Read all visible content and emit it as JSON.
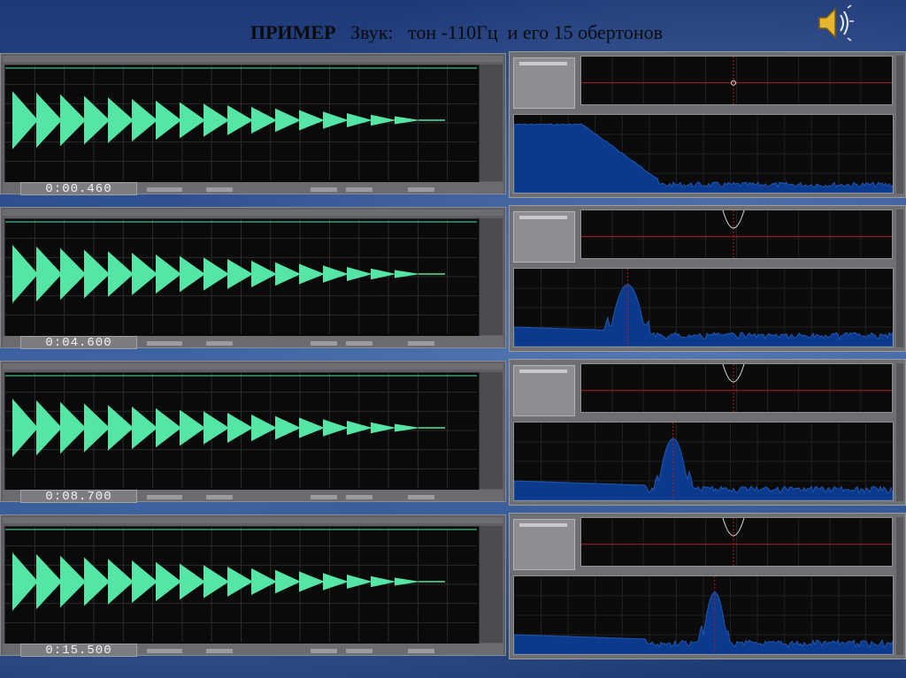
{
  "header": {
    "title_bold": "ПРИМЕР",
    "title_rest": "Звук:   тон -110Гц  и его 15 обертонов",
    "speaker_icon": "speaker-volume-icon"
  },
  "colors": {
    "waveform": "#55e6a6",
    "spectrum": "#0b3a8c",
    "spectrum_edge": "#1f57b5",
    "grid": "#2b2b2b",
    "red_line": "#b32020"
  },
  "panels": [
    {
      "time": "0:00.460",
      "peak_fraction": 0.0
    },
    {
      "time": "0:04.600",
      "peak_fraction": 0.3
    },
    {
      "time": "0:08.700",
      "peak_fraction": 0.42
    },
    {
      "time": "0:15.500",
      "peak_fraction": 0.53
    }
  ],
  "waveform": {
    "pulses": 17
  }
}
